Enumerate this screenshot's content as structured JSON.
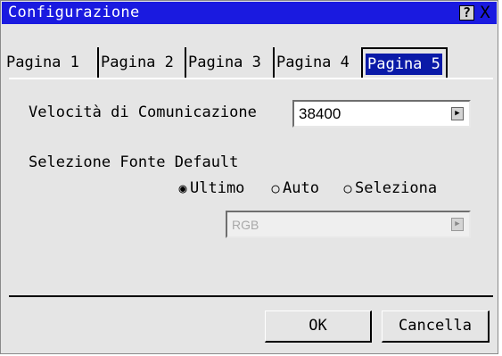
{
  "window": {
    "title": "Configurazione",
    "help_icon": "?",
    "close_icon": "X"
  },
  "tabs": [
    {
      "label": "Pagina 1",
      "selected": false
    },
    {
      "label": "Pagina 2",
      "selected": false
    },
    {
      "label": "Pagina 3",
      "selected": false
    },
    {
      "label": "Pagina 4",
      "selected": false
    },
    {
      "label": "Pagina 5",
      "selected": true
    }
  ],
  "comm_speed": {
    "label": "Velocità di Comunicazione",
    "value": "38400"
  },
  "default_source": {
    "label": "Selezione Fonte Default",
    "options": [
      {
        "label": "Ultimo",
        "selected": true
      },
      {
        "label": "Auto",
        "selected": false
      },
      {
        "label": "Seleziona",
        "selected": false
      }
    ],
    "source_value": "RGB",
    "source_enabled": false
  },
  "buttons": {
    "ok": "OK",
    "cancel": "Cancella"
  },
  "colors": {
    "titlebar": "#1a1ae0",
    "selected_tab": "#0a1aa8",
    "background": "#e5e5e5"
  }
}
